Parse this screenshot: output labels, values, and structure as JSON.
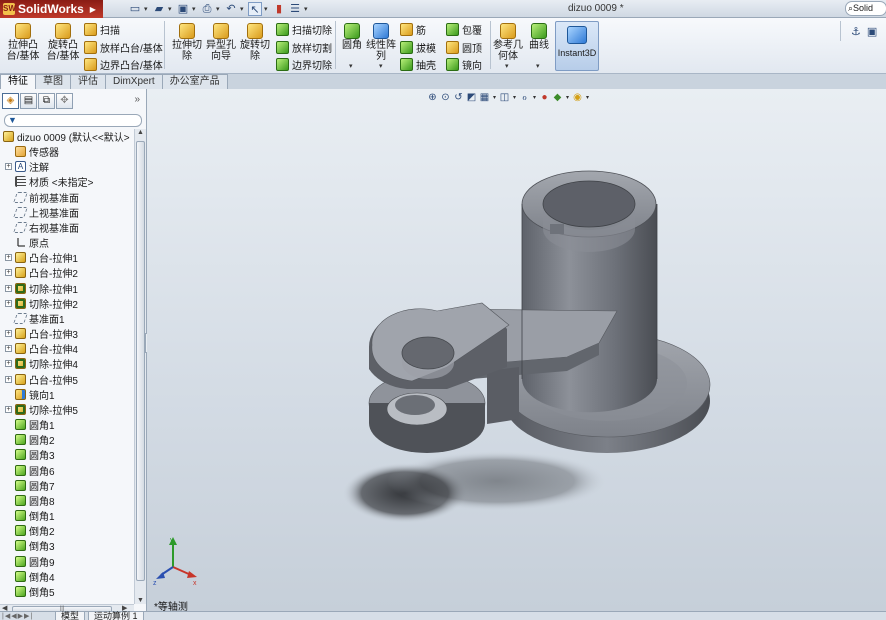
{
  "app": {
    "logo_text": "SolidWorks",
    "logo_mark": "SW",
    "document_title": "dizuo 0009 *",
    "search_text": "Solid"
  },
  "quick_access": {
    "icons": [
      "new-icon",
      "open-icon",
      "save-icon",
      "print-icon",
      "undo-icon",
      "select-icon",
      "rebuild-icon",
      "options-icon"
    ]
  },
  "ribbon": {
    "extrude_boss": "拉伸凸\n台/基体",
    "revolve_boss": "旋转凸\n台/基体",
    "sweep": "扫描",
    "loft": "放样凸台/基体",
    "boundary_boss": "边界凸台/基体",
    "extrude_cut": "拉伸切\n除",
    "hole_wizard": "异型孔\n向导",
    "revolve_cut": "旋转切\n除",
    "swept_cut": "扫描切除",
    "lofted_cut": "放样切割",
    "boundary_cut": "边界切除",
    "fillet": "圆角",
    "linear_pattern": "线性阵\n列",
    "rib": "筋",
    "draft": "拔模",
    "shell": "抽壳",
    "wrap": "包覆",
    "dome": "圆顶",
    "mirror": "镜向",
    "reference_geometry": "参考几\n何体",
    "curves": "曲线",
    "instant3d": "Instant3D"
  },
  "tabs": [
    "特征",
    "草图",
    "评估",
    "DimXpert",
    "办公室产品"
  ],
  "active_tab_index": 0,
  "panel": {
    "tabs": [
      "feature-manager-icon",
      "property-manager-icon",
      "configuration-manager-icon",
      "dimxpert-manager-icon"
    ],
    "more": "»",
    "filter_glyph": "▼"
  },
  "tree": {
    "root": "dizuo 0009  (默认<<默认>",
    "items": [
      {
        "label": "传感器",
        "icon": "sensor",
        "expand": false
      },
      {
        "label": "注解",
        "icon": "annotation",
        "expand": true
      },
      {
        "label": "材质 <未指定>",
        "icon": "material",
        "expand": false
      },
      {
        "label": "前视基准面",
        "icon": "plane",
        "expand": false
      },
      {
        "label": "上视基准面",
        "icon": "plane",
        "expand": false
      },
      {
        "label": "右视基准面",
        "icon": "plane",
        "expand": false
      },
      {
        "label": "原点",
        "icon": "origin",
        "expand": false
      },
      {
        "label": "凸台-拉伸1",
        "icon": "feat",
        "expand": true
      },
      {
        "label": "凸台-拉伸2",
        "icon": "feat",
        "expand": true
      },
      {
        "label": "切除-拉伸1",
        "icon": "cut",
        "expand": true
      },
      {
        "label": "切除-拉伸2",
        "icon": "cut",
        "expand": true
      },
      {
        "label": "基准面1",
        "icon": "plane",
        "expand": false
      },
      {
        "label": "凸台-拉伸3",
        "icon": "feat",
        "expand": true
      },
      {
        "label": "凸台-拉伸4",
        "icon": "feat",
        "expand": true
      },
      {
        "label": "切除-拉伸4",
        "icon": "cut",
        "expand": true
      },
      {
        "label": "凸台-拉伸5",
        "icon": "feat",
        "expand": true
      },
      {
        "label": "镜向1",
        "icon": "mirror",
        "expand": false
      },
      {
        "label": "切除-拉伸5",
        "icon": "cut",
        "expand": true
      },
      {
        "label": "圆角1",
        "icon": "fillet",
        "expand": false
      },
      {
        "label": "圆角2",
        "icon": "fillet",
        "expand": false
      },
      {
        "label": "圆角3",
        "icon": "fillet",
        "expand": false
      },
      {
        "label": "圆角6",
        "icon": "fillet",
        "expand": false
      },
      {
        "label": "圆角7",
        "icon": "fillet",
        "expand": false
      },
      {
        "label": "圆角8",
        "icon": "fillet",
        "expand": false
      },
      {
        "label": "倒角1",
        "icon": "fillet",
        "expand": false
      },
      {
        "label": "倒角2",
        "icon": "fillet",
        "expand": false
      },
      {
        "label": "倒角3",
        "icon": "fillet",
        "expand": false
      },
      {
        "label": "圆角9",
        "icon": "fillet",
        "expand": false
      },
      {
        "label": "倒角4",
        "icon": "fillet",
        "expand": false
      },
      {
        "label": "倒角5",
        "icon": "fillet",
        "expand": false
      }
    ]
  },
  "bottom_tabs": [
    "模型",
    "运动算例 1"
  ],
  "viewport": {
    "view_label": "*等轴测",
    "triad_axes": [
      "x",
      "y",
      "z"
    ],
    "heads_up_icons": [
      "zoom-to-fit-icon",
      "zoom-area-icon",
      "previous-view-icon",
      "section-view-icon",
      "view-orientation-icon",
      "display-style-icon",
      "hide-show-icon",
      "edit-appearance-icon",
      "apply-scene-icon",
      "view-settings-icon"
    ]
  },
  "colors": {
    "model_body": "#7b7f88",
    "model_highlight": "#b4b8bf",
    "model_shadow": "#44474d",
    "brand_red": "#b02a1e"
  }
}
